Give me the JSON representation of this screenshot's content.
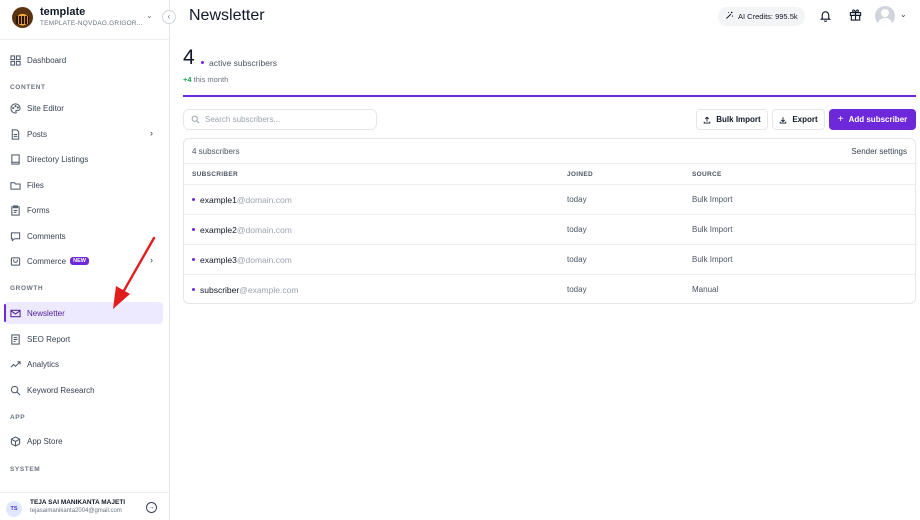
{
  "brand": {
    "name": "template",
    "subtitle": "TEMPLATE-NQVDAG.GRIGOR..."
  },
  "sidebar": {
    "items": [
      {
        "label": "Dashboard",
        "icon": "dashboard-icon"
      },
      {
        "label": "Site Editor",
        "icon": "palette-icon"
      },
      {
        "label": "Posts",
        "icon": "document-icon"
      },
      {
        "label": "Directory Listings",
        "icon": "book-icon"
      },
      {
        "label": "Files",
        "icon": "folder-icon"
      },
      {
        "label": "Forms",
        "icon": "clipboard-icon"
      },
      {
        "label": "Comments",
        "icon": "comment-icon"
      },
      {
        "label": "Commerce",
        "icon": "cart-icon",
        "badge": "NEW"
      },
      {
        "label": "Newsletter",
        "icon": "mail-icon",
        "active": true
      },
      {
        "label": "SEO Report",
        "icon": "report-icon"
      },
      {
        "label": "Analytics",
        "icon": "analytics-icon"
      },
      {
        "label": "Keyword Research",
        "icon": "search-icon"
      },
      {
        "label": "App Store",
        "icon": "box-icon"
      }
    ],
    "sections": {
      "content": "CONTENT",
      "growth": "GROWTH",
      "app": "APP",
      "system": "SYSTEM"
    }
  },
  "user": {
    "initials": "TS",
    "name": "TEJA SAI MANIKANTA MAJETI",
    "email": "tejasaimanikanta2004@gmail.com"
  },
  "header": {
    "title": "Newsletter",
    "credits": "AI Credits: 995.5k"
  },
  "stats": {
    "count": "4",
    "label": "active subscribers",
    "delta": "+4",
    "delta_suffix": "this month"
  },
  "toolbar": {
    "search_placeholder": "Search subscribers...",
    "bulk_import": "Bulk Import",
    "export": "Export",
    "add_subscriber": "Add subscriber"
  },
  "table": {
    "count_label": "4 subscribers",
    "settings_label": "Sender settings",
    "columns": [
      "SUBSCRIBER",
      "JOINED",
      "SOURCE"
    ],
    "rows": [
      {
        "local": "example1",
        "domain": "@domain.com",
        "joined": "today",
        "source": "Bulk Import"
      },
      {
        "local": "example2",
        "domain": "@domain.com",
        "joined": "today",
        "source": "Bulk Import"
      },
      {
        "local": "example3",
        "domain": "@domain.com",
        "joined": "today",
        "source": "Bulk Import"
      },
      {
        "local": "subscriber",
        "domain": "@example.com",
        "joined": "today",
        "source": "Manual"
      }
    ]
  },
  "colors": {
    "accent": "#6d28d9",
    "annotation": "#e11d1d",
    "positive": "#16a34a"
  }
}
